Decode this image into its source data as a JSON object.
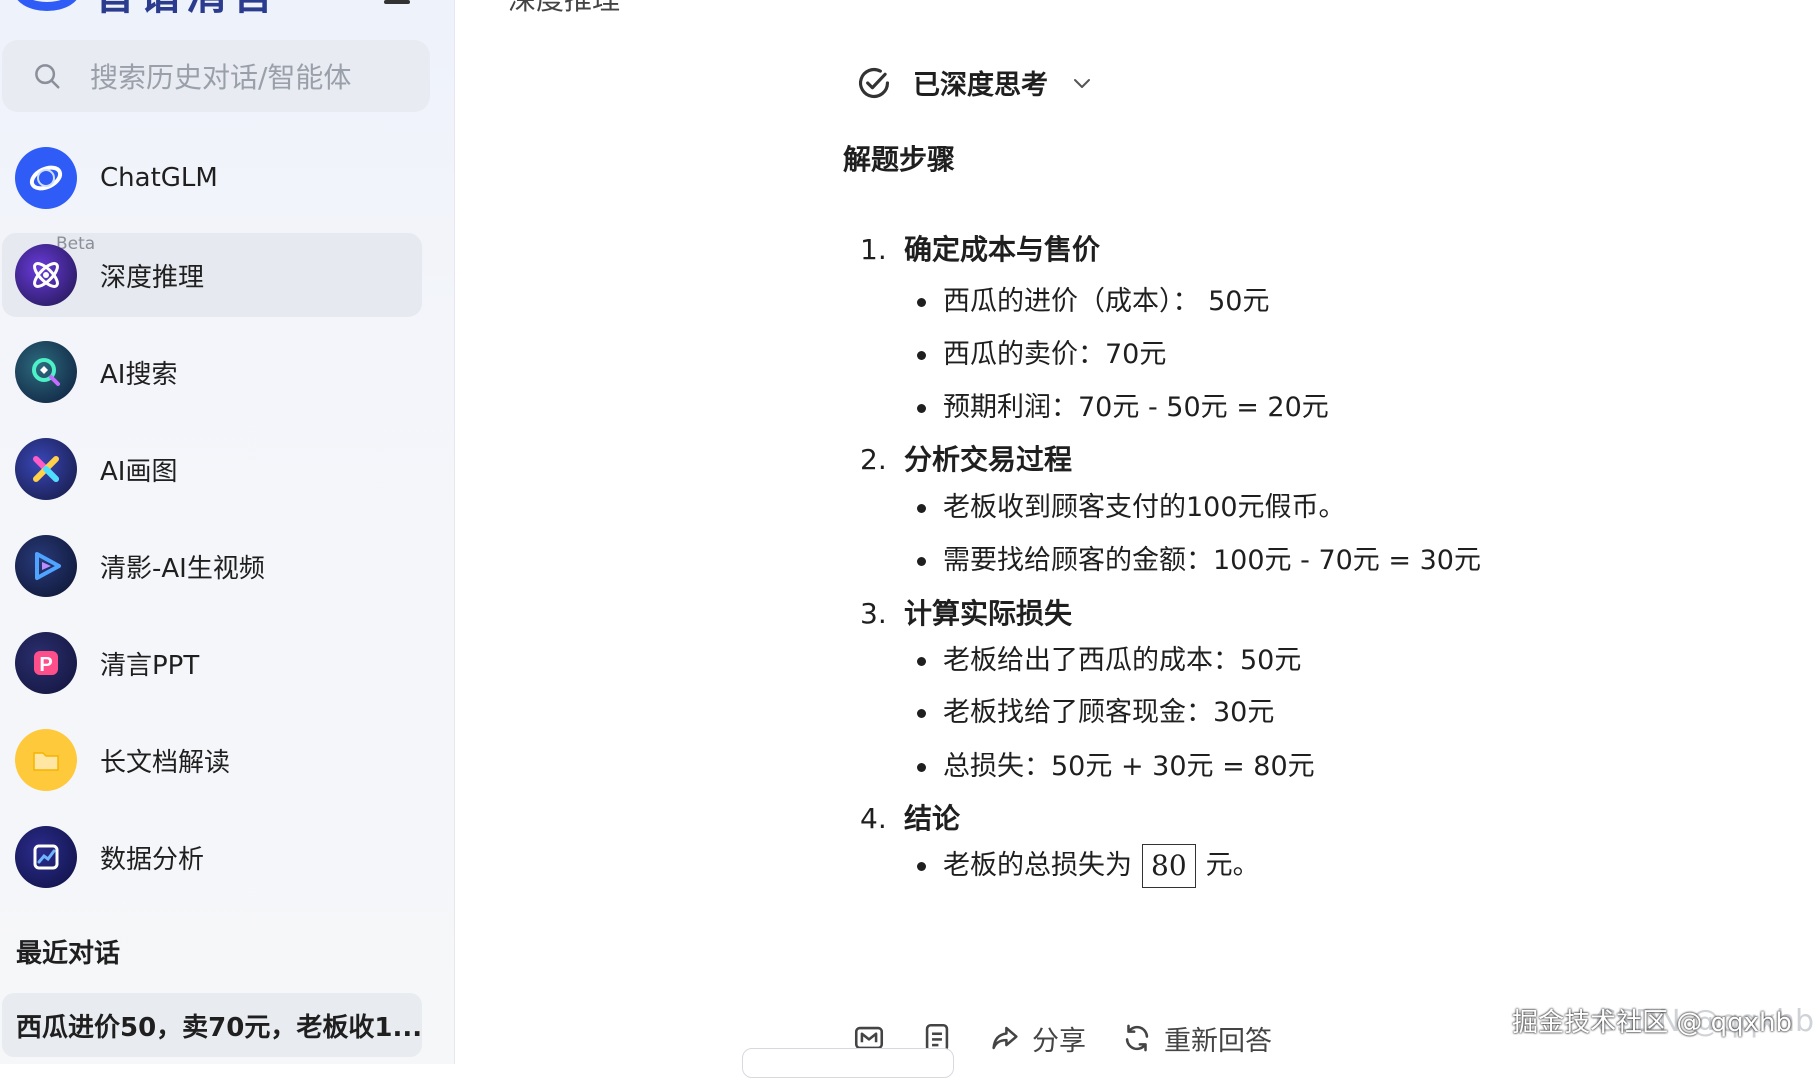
{
  "sidebar": {
    "logo_text": "智谱清言",
    "search": {
      "placeholder": "搜索历史对话/智能体"
    },
    "items": [
      {
        "label": "ChatGLM",
        "icon": "chatglm-icon"
      },
      {
        "label": "深度推理",
        "icon": "reasoning-icon",
        "badge": "Beta"
      },
      {
        "label": "AI搜索",
        "icon": "ai-search-icon"
      },
      {
        "label": "AI画图",
        "icon": "ai-draw-icon"
      },
      {
        "label": "清影-AI生视频",
        "icon": "video-icon"
      },
      {
        "label": "清言PPT",
        "icon": "ppt-icon"
      },
      {
        "label": "长文档解读",
        "icon": "document-icon"
      },
      {
        "label": "数据分析",
        "icon": "chart-icon"
      }
    ],
    "recent_title": "最近对话",
    "recent_items": [
      "西瓜进价50，卖70元，老板收1..."
    ]
  },
  "main": {
    "top_title": "深度推理",
    "thinking_label": "已深度思考",
    "answer_title": "解题步骤",
    "steps": [
      {
        "num": "1.",
        "title": "确定成本与售价",
        "bullets": [
          "西瓜的进价（成本）：  50元",
          "西瓜的卖价：70元",
          "预期利润：70元 - 50元 = 20元"
        ]
      },
      {
        "num": "2.",
        "title": "分析交易过程",
        "bullets": [
          "老板收到顾客支付的100元假币。",
          "需要找给顾客的金额：100元 - 70元 = 30元"
        ]
      },
      {
        "num": "3.",
        "title": "计算实际损失",
        "bullets": [
          "老板给出了西瓜的成本：50元",
          "老板找给了顾客现金：30元",
          "总损失：50元 + 30元 = 80元"
        ]
      },
      {
        "num": "4.",
        "title": "结论",
        "conclusion": {
          "before": "老板的总损失为",
          "boxed": "80",
          "after": "元。"
        }
      }
    ],
    "actions": {
      "share": "分享",
      "regenerate": "重新回答"
    }
  },
  "watermark": {
    "csdn": "CSDN @qqxhb",
    "juejin": "掘金技术社区 @ qqxhb"
  },
  "colors": {
    "brand": "#2f5cf6",
    "sidebar_bg": "#f3f5fa",
    "active_item": "#e6e9ef"
  }
}
